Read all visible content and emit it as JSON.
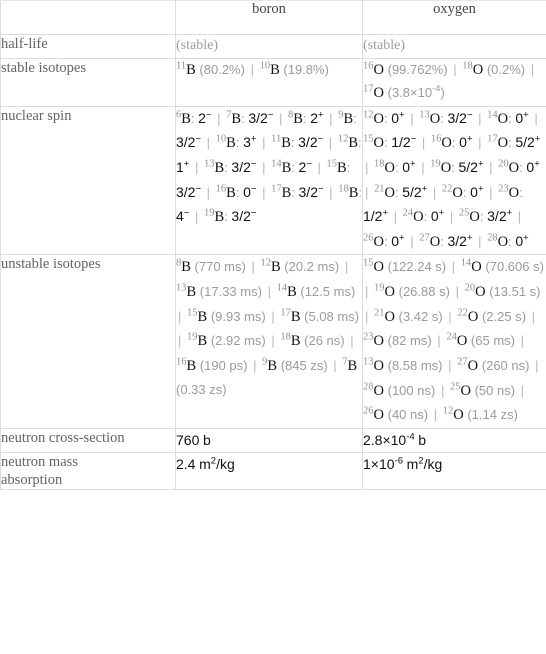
{
  "table": {
    "columns": [
      {
        "key": "label",
        "label": ""
      },
      {
        "key": "boron",
        "label": "boron"
      },
      {
        "key": "oxygen",
        "label": "oxygen"
      }
    ],
    "rows": [
      {
        "label": "half-life",
        "boron": {
          "text": "(stable)"
        },
        "oxygen": {
          "text": "(stable)"
        }
      },
      {
        "label": "stable isotopes",
        "boron": {
          "items": [
            {
              "mass": "11",
              "symbol": "B",
              "value": "(80.2%)"
            },
            {
              "mass": "10",
              "symbol": "B",
              "value": "(19.8%)"
            }
          ]
        },
        "oxygen": {
          "items": [
            {
              "mass": "16",
              "symbol": "O",
              "value": "(99.762%)"
            },
            {
              "mass": "18",
              "symbol": "O",
              "value": "(0.2%)"
            },
            {
              "mass": "17",
              "symbol": "O",
              "value": "(3.8×10−4)",
              "mantissa": "3.8",
              "base": "10",
              "exponent": "-4"
            }
          ]
        }
      },
      {
        "label": "nuclear spin",
        "boron": {
          "items": [
            {
              "mass": "6",
              "symbol": "B",
              "spin": "2−",
              "spin_value": "2",
              "spin_parity": "−"
            },
            {
              "mass": "7",
              "symbol": "B",
              "spin": "3/2−",
              "spin_value": "3/2",
              "spin_parity": "−"
            },
            {
              "mass": "8",
              "symbol": "B",
              "spin": "2+",
              "spin_value": "2",
              "spin_parity": "+"
            },
            {
              "mass": "9",
              "symbol": "B",
              "spin": "3/2−",
              "spin_value": "3/2",
              "spin_parity": "−"
            },
            {
              "mass": "10",
              "symbol": "B",
              "spin": "3+",
              "spin_value": "3",
              "spin_parity": "+"
            },
            {
              "mass": "11",
              "symbol": "B",
              "spin": "3/2−",
              "spin_value": "3/2",
              "spin_parity": "−"
            },
            {
              "mass": "12",
              "symbol": "B",
              "spin": "1+",
              "spin_value": "1",
              "spin_parity": "+"
            },
            {
              "mass": "13",
              "symbol": "B",
              "spin": "3/2−",
              "spin_value": "3/2",
              "spin_parity": "−"
            },
            {
              "mass": "14",
              "symbol": "B",
              "spin": "2−",
              "spin_value": "2",
              "spin_parity": "−"
            },
            {
              "mass": "15",
              "symbol": "B",
              "spin": "3/2−",
              "spin_value": "3/2",
              "spin_parity": "−"
            },
            {
              "mass": "16",
              "symbol": "B",
              "spin": "0−",
              "spin_value": "0",
              "spin_parity": "−"
            },
            {
              "mass": "17",
              "symbol": "B",
              "spin": "3/2−",
              "spin_value": "3/2",
              "spin_parity": "−"
            },
            {
              "mass": "18",
              "symbol": "B",
              "spin": "4−",
              "spin_value": "4",
              "spin_parity": "−"
            },
            {
              "mass": "19",
              "symbol": "B",
              "spin": "3/2−",
              "spin_value": "3/2",
              "spin_parity": "−"
            }
          ]
        },
        "oxygen": {
          "items": [
            {
              "mass": "12",
              "symbol": "O",
              "spin_value": "0",
              "spin_parity": "+"
            },
            {
              "mass": "13",
              "symbol": "O",
              "spin_value": "3/2",
              "spin_parity": "−"
            },
            {
              "mass": "14",
              "symbol": "O",
              "spin_value": "0",
              "spin_parity": "+"
            },
            {
              "mass": "15",
              "symbol": "O",
              "spin_value": "1/2",
              "spin_parity": "−"
            },
            {
              "mass": "16",
              "symbol": "O",
              "spin_value": "0",
              "spin_parity": "+"
            },
            {
              "mass": "17",
              "symbol": "O",
              "spin_value": "5/2",
              "spin_parity": "+"
            },
            {
              "mass": "18",
              "symbol": "O",
              "spin_value": "0",
              "spin_parity": "+"
            },
            {
              "mass": "19",
              "symbol": "O",
              "spin_value": "5/2",
              "spin_parity": "+"
            },
            {
              "mass": "20",
              "symbol": "O",
              "spin_value": "0",
              "spin_parity": "+"
            },
            {
              "mass": "21",
              "symbol": "O",
              "spin_value": "5/2",
              "spin_parity": "+"
            },
            {
              "mass": "22",
              "symbol": "O",
              "spin_value": "0",
              "spin_parity": "+"
            },
            {
              "mass": "23",
              "symbol": "O",
              "spin_value": "1/2",
              "spin_parity": "+"
            },
            {
              "mass": "24",
              "symbol": "O",
              "spin_value": "0",
              "spin_parity": "+"
            },
            {
              "mass": "25",
              "symbol": "O",
              "spin_value": "3/2",
              "spin_parity": "+"
            },
            {
              "mass": "26",
              "symbol": "O",
              "spin_value": "0",
              "spin_parity": "+"
            },
            {
              "mass": "27",
              "symbol": "O",
              "spin_value": "3/2",
              "spin_parity": "+"
            },
            {
              "mass": "28",
              "symbol": "O",
              "spin_value": "0",
              "spin_parity": "+"
            }
          ]
        }
      },
      {
        "label": "unstable isotopes",
        "boron": {
          "items": [
            {
              "mass": "8",
              "symbol": "B",
              "value": "(770 ms)"
            },
            {
              "mass": "12",
              "symbol": "B",
              "value": "(20.2 ms)"
            },
            {
              "mass": "13",
              "symbol": "B",
              "value": "(17.33 ms)"
            },
            {
              "mass": "14",
              "symbol": "B",
              "value": "(12.5 ms)"
            },
            {
              "mass": "15",
              "symbol": "B",
              "value": "(9.93 ms)"
            },
            {
              "mass": "17",
              "symbol": "B",
              "value": "(5.08 ms)"
            },
            {
              "mass": "19",
              "symbol": "B",
              "value": "(2.92 ms)"
            },
            {
              "mass": "18",
              "symbol": "B",
              "value": "(26 ns)"
            },
            {
              "mass": "16",
              "symbol": "B",
              "value": "(190 ps)"
            },
            {
              "mass": "9",
              "symbol": "B",
              "value": "(845 zs)"
            },
            {
              "mass": "7",
              "symbol": "B",
              "value": "(0.33 zs)"
            }
          ]
        },
        "oxygen": {
          "items": [
            {
              "mass": "15",
              "symbol": "O",
              "value": "(122.24 s)"
            },
            {
              "mass": "14",
              "symbol": "O",
              "value": "(70.606 s)"
            },
            {
              "mass": "19",
              "symbol": "O",
              "value": "(26.88 s)"
            },
            {
              "mass": "20",
              "symbol": "O",
              "value": "(13.51 s)"
            },
            {
              "mass": "21",
              "symbol": "O",
              "value": "(3.42 s)"
            },
            {
              "mass": "22",
              "symbol": "O",
              "value": "(2.25 s)"
            },
            {
              "mass": "23",
              "symbol": "O",
              "value": "(82 ms)"
            },
            {
              "mass": "24",
              "symbol": "O",
              "value": "(65 ms)"
            },
            {
              "mass": "13",
              "symbol": "O",
              "value": "(8.58 ms)"
            },
            {
              "mass": "27",
              "symbol": "O",
              "value": "(260 ns)"
            },
            {
              "mass": "28",
              "symbol": "O",
              "value": "(100 ns)"
            },
            {
              "mass": "25",
              "symbol": "O",
              "value": "(50 ns)"
            },
            {
              "mass": "26",
              "symbol": "O",
              "value": "(40 ns)"
            },
            {
              "mass": "12",
              "symbol": "O",
              "value": "(1.14 zs)"
            }
          ]
        }
      },
      {
        "label": "neutron cross-section",
        "boron": {
          "number": "760",
          "unit": "b"
        },
        "oxygen": {
          "mantissa": "2.8",
          "base": "10",
          "exponent": "-4",
          "unit": "b"
        }
      },
      {
        "label": "neutron mass\nabsorption",
        "boron": {
          "number": "2.4",
          "unit": "m2/kg",
          "unit_base": "m",
          "unit_exp": "2",
          "unit_tail": "/kg"
        },
        "oxygen": {
          "mantissa": "1",
          "base": "10",
          "exponent": "-6",
          "unit": "m2/kg",
          "unit_base": "m",
          "unit_exp": "2",
          "unit_tail": "/kg"
        }
      }
    ]
  },
  "colors": {
    "border": "#dcdcdc",
    "label_text": "#646464",
    "header_text": "#454545",
    "muted_text": "#9a9a9a",
    "value_text": "#111111",
    "separator": "#b7b7b7",
    "background": "#ffffff"
  },
  "separator_glyph": "|"
}
